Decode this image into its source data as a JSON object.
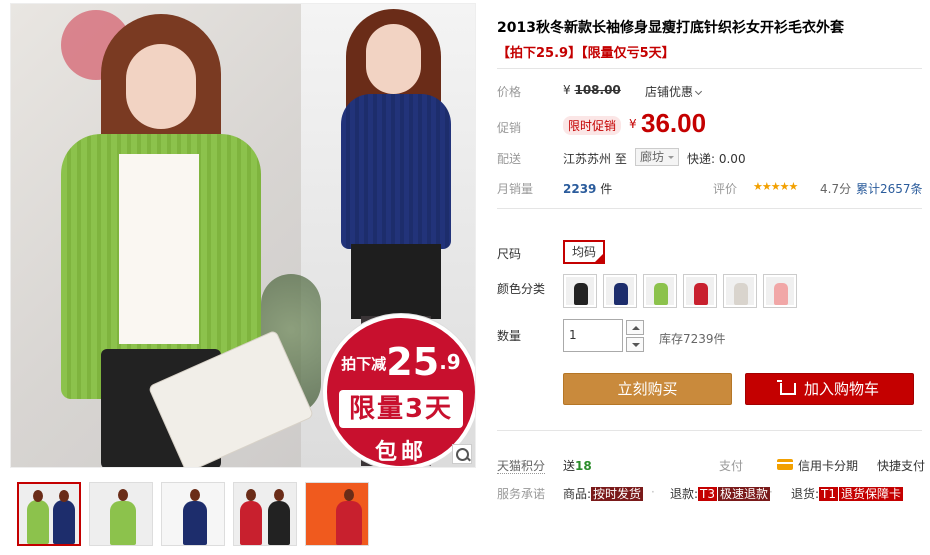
{
  "product": {
    "title": "2013秋冬新款长袖修身显瘦打底针织衫女开衫毛衣外套",
    "subtitle": "【拍下25.9】【限量仅亏5天】"
  },
  "promo_badge": {
    "line1_prefix": "拍下减",
    "line1_big": "25",
    "line1_small": ".9",
    "line2": "限量3天",
    "line3": "包邮"
  },
  "price": {
    "label": "价格",
    "currency": "¥",
    "original": "108.00",
    "store_discount": "店铺优惠"
  },
  "promotion": {
    "label": "促销",
    "tag": "限时促销",
    "currency": "¥",
    "value": "36.00"
  },
  "shipping": {
    "label": "配送",
    "from": "江苏苏州",
    "to_word": "至",
    "to": "廊坊",
    "fee": "快递: 0.00"
  },
  "sales": {
    "label": "月销量",
    "count": "2239",
    "unit": "件",
    "rating_label": "评价",
    "stars": "★★★★★",
    "score": "4.7分",
    "total_reviews": "累计2657条"
  },
  "size": {
    "label": "尺码",
    "option": "均码"
  },
  "color": {
    "label": "颜色分类",
    "options": [
      {
        "name": "black",
        "hex": "#222222"
      },
      {
        "name": "navy",
        "hex": "#1d2d6c"
      },
      {
        "name": "green",
        "hex": "#8cc24c"
      },
      {
        "name": "red",
        "hex": "#c8202e"
      },
      {
        "name": "white",
        "hex": "#efebe6"
      },
      {
        "name": "pink",
        "hex": "#f1a7a7"
      }
    ]
  },
  "quantity": {
    "label": "数量",
    "value": "1",
    "stock": "库存7239件"
  },
  "buttons": {
    "buy_now": "立刻购买",
    "add_to_cart": "加入购物车"
  },
  "points": {
    "label": "天猫积分",
    "prefix": "送",
    "value": "18"
  },
  "payment": {
    "label": "支付",
    "credit": "信用卡分期",
    "quick": "快捷支付"
  },
  "service": {
    "label": "服务承诺",
    "goods_label": "商品:",
    "goods_tag": "按时发货",
    "refund_label": "退款:",
    "refund_code": "T3",
    "refund_tag": "极速退款",
    "return_label": "退货:",
    "return_code": "T1",
    "return_tag": "退货保障卡"
  },
  "colors": {
    "accent": "#c40000",
    "buy_button": "#c98a3c",
    "link_blue": "#2b5c9c"
  }
}
